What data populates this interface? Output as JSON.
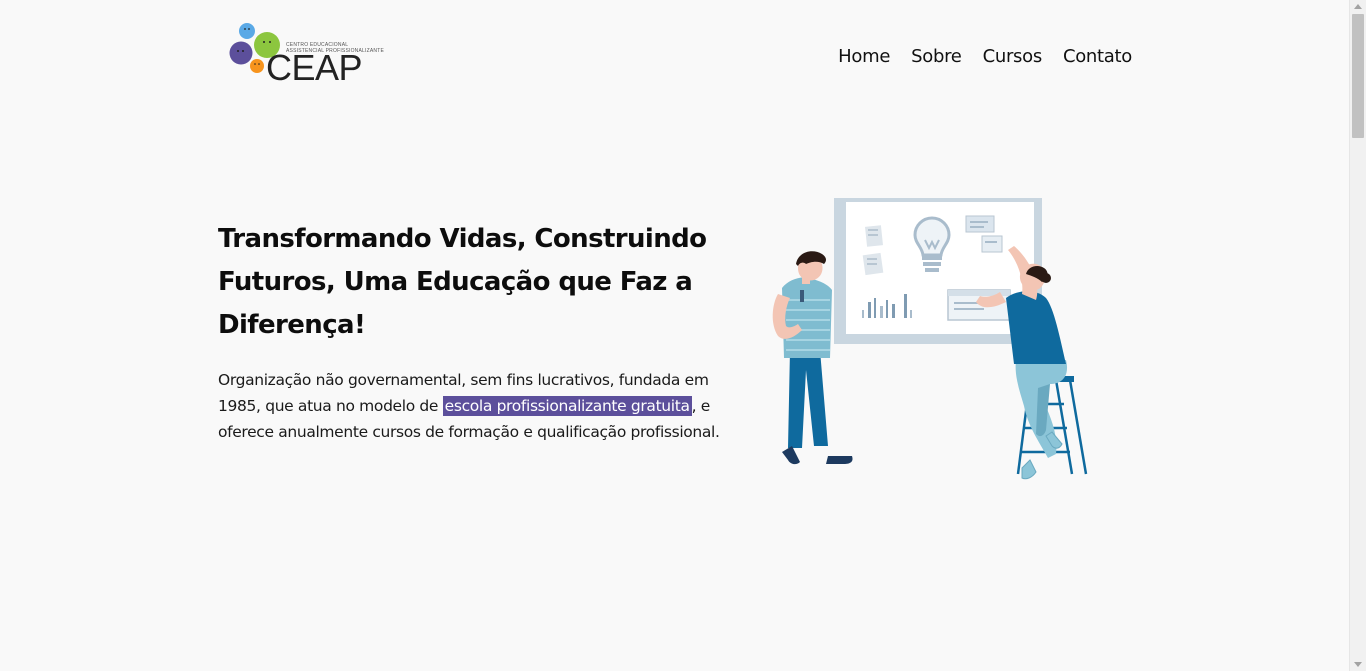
{
  "header": {
    "logo": {
      "wordmark": "CEAP",
      "tagline_line1": "CENTRO EDUCACIONAL",
      "tagline_line2": "ASSISTENCIAL PROFISSIONALIZANTE",
      "circle_colors": [
        "#5c4f9b",
        "#8cc63f",
        "#5aa9e6",
        "#f7941d"
      ]
    },
    "nav": [
      {
        "label": "Home"
      },
      {
        "label": "Sobre"
      },
      {
        "label": "Cursos"
      },
      {
        "label": "Contato"
      }
    ]
  },
  "hero": {
    "title": "Transformando Vidas, Construindo Futuros, Uma Educação que Faz a Diferença!",
    "description_before": "Organização não governamental, sem fins lucrativos, fundada em 1985, que atua no modelo de ",
    "description_highlight": "escola profissionalizante gratuita",
    "description_after": ", e oferece anualmente cursos de formação e qualificação profissional.",
    "highlight_color": "#5c4f9b",
    "illustration_icon": "team-whiteboard-illustration"
  }
}
